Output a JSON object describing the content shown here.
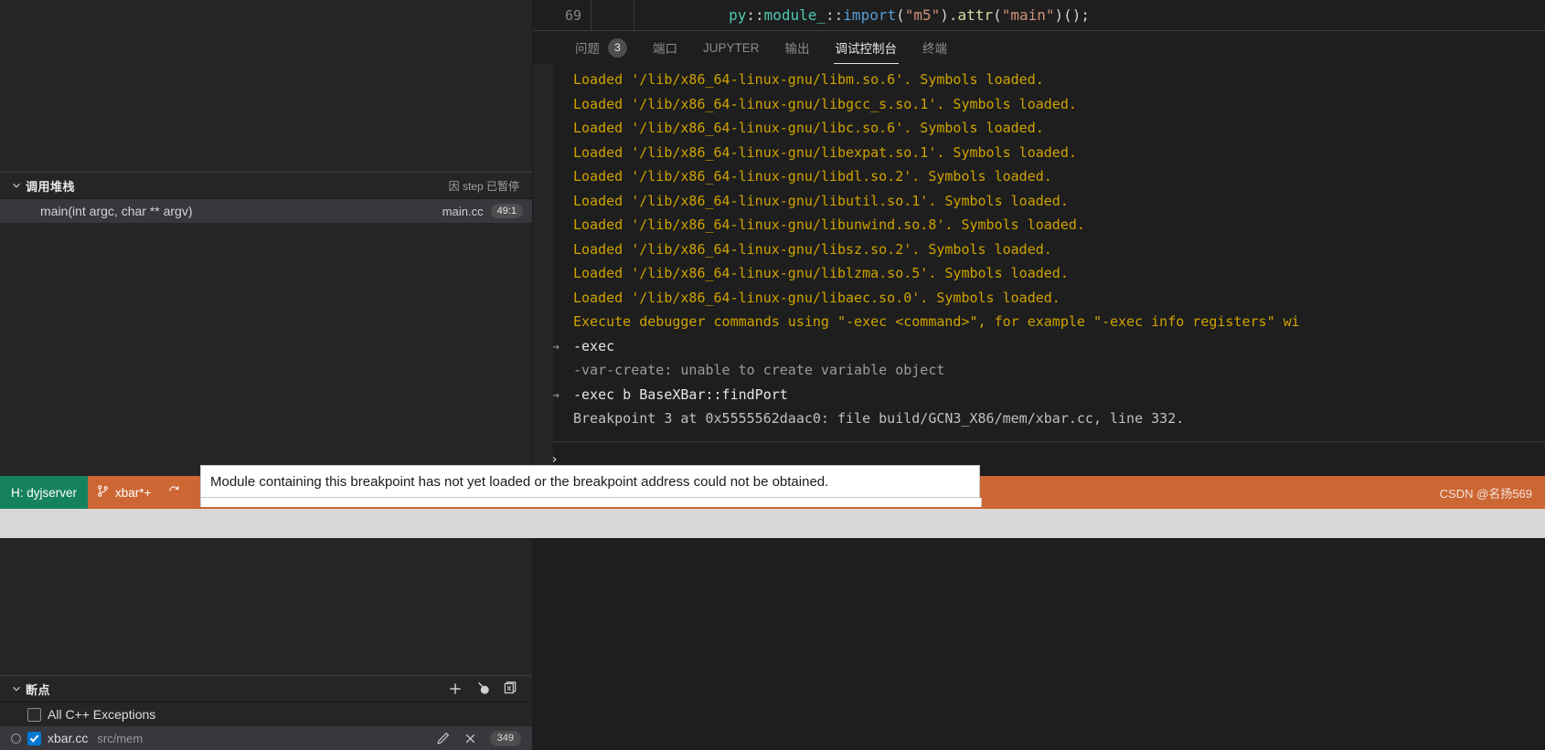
{
  "editor": {
    "line_number": "69",
    "code_tokens": [
      {
        "t": "py",
        "c": "green"
      },
      {
        "t": "::",
        "c": "white"
      },
      {
        "t": "module_",
        "c": "green"
      },
      {
        "t": "::",
        "c": "white"
      },
      {
        "t": "import",
        "c": "blue"
      },
      {
        "t": "(",
        "c": "white"
      },
      {
        "t": "\"m5\"",
        "c": "orange"
      },
      {
        "t": ")",
        "c": "white"
      },
      {
        "t": ".",
        "c": "white"
      },
      {
        "t": "attr",
        "c": "yellow"
      },
      {
        "t": "(",
        "c": "white"
      },
      {
        "t": "\"main\"",
        "c": "orange"
      },
      {
        "t": ")",
        "c": "white"
      },
      {
        "t": "();",
        "c": "white"
      }
    ]
  },
  "panel": {
    "tabs": [
      {
        "label": "问题",
        "badge": "3",
        "active": false
      },
      {
        "label": "端口",
        "badge": null,
        "active": false
      },
      {
        "label": "JUPYTER",
        "badge": null,
        "active": false
      },
      {
        "label": "输出",
        "badge": null,
        "active": false
      },
      {
        "label": "调试控制台",
        "badge": null,
        "active": true
      },
      {
        "label": "终端",
        "badge": null,
        "active": false
      }
    ]
  },
  "console": {
    "lines": [
      {
        "arrow": false,
        "text": "Loaded '/lib/x86_64-linux-gnu/libm.so.6'. Symbols loaded.",
        "color": "yellow"
      },
      {
        "arrow": false,
        "text": "Loaded '/lib/x86_64-linux-gnu/libgcc_s.so.1'. Symbols loaded.",
        "color": "yellow"
      },
      {
        "arrow": false,
        "text": "Loaded '/lib/x86_64-linux-gnu/libc.so.6'. Symbols loaded.",
        "color": "yellow"
      },
      {
        "arrow": false,
        "text": "Loaded '/lib/x86_64-linux-gnu/libexpat.so.1'. Symbols loaded.",
        "color": "yellow"
      },
      {
        "arrow": false,
        "text": "Loaded '/lib/x86_64-linux-gnu/libdl.so.2'. Symbols loaded.",
        "color": "yellow"
      },
      {
        "arrow": false,
        "text": "Loaded '/lib/x86_64-linux-gnu/libutil.so.1'. Symbols loaded.",
        "color": "yellow"
      },
      {
        "arrow": false,
        "text": "Loaded '/lib/x86_64-linux-gnu/libunwind.so.8'. Symbols loaded.",
        "color": "yellow"
      },
      {
        "arrow": false,
        "text": "Loaded '/lib/x86_64-linux-gnu/libsz.so.2'. Symbols loaded.",
        "color": "yellow"
      },
      {
        "arrow": false,
        "text": "Loaded '/lib/x86_64-linux-gnu/liblzma.so.5'. Symbols loaded.",
        "color": "yellow"
      },
      {
        "arrow": false,
        "text": "Loaded '/lib/x86_64-linux-gnu/libaec.so.0'. Symbols loaded.",
        "color": "yellow"
      },
      {
        "arrow": false,
        "text": "Execute debugger commands using \"-exec <command>\", for example \"-exec info registers\" wi",
        "color": "yellow"
      },
      {
        "arrow": true,
        "text": "-exec",
        "color": "white"
      },
      {
        "arrow": false,
        "text": "-var-create: unable to create variable object",
        "color": "grey"
      },
      {
        "arrow": true,
        "text": "-exec b BaseXBar::findPort",
        "color": "white"
      },
      {
        "arrow": false,
        "text": "Breakpoint 3 at 0x5555562daac0: file build/GCN3_X86/mem/xbar.cc, line 332.",
        "color": "lightgrey"
      }
    ],
    "prompt": "›"
  },
  "callstack": {
    "title": "调用堆栈",
    "pause_reason": "因 step 已暂停",
    "frames": [
      {
        "fn": "main(int argc, char ** argv)",
        "file": "main.cc",
        "line": "49:1"
      }
    ]
  },
  "breakpoints": {
    "title": "断点",
    "items": [
      {
        "label": "All C++ Exceptions",
        "path": "",
        "checked": false,
        "selected": false,
        "warn": false,
        "line": ""
      },
      {
        "label": "xbar.cc",
        "path": "src/mem",
        "checked": true,
        "selected": true,
        "warn": true,
        "line": "349"
      }
    ],
    "actions": {
      "add": "add-breakpoint",
      "toggle": "toggle-activate-breakpoints",
      "remove_all": "remove-all-breakpoints",
      "edit": "edit-condition",
      "close": "remove-breakpoint"
    }
  },
  "statusbar": {
    "remote": "H: dyjserver",
    "branch": "xbar*+",
    "sync": "sync-icon",
    "watermark": "CSDN @名扬569"
  },
  "tooltip": {
    "message": "Module containing this breakpoint has not yet loaded or the breakpoint address could not be obtained."
  }
}
